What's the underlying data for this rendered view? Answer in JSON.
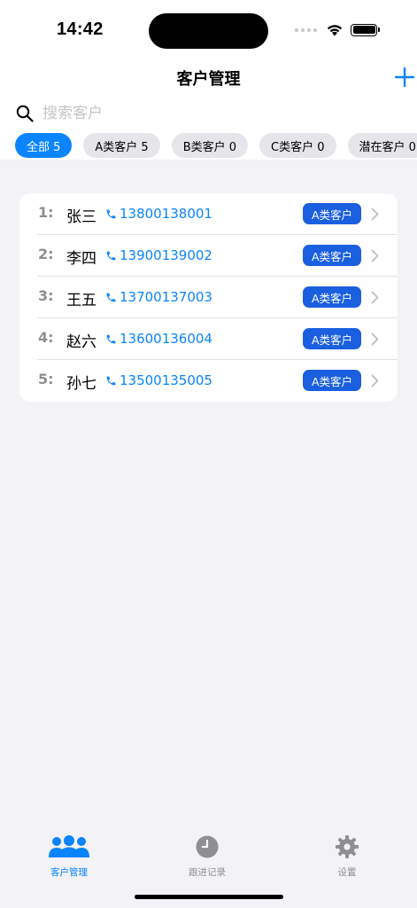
{
  "status_bar": {
    "time": "14:42"
  },
  "nav": {
    "title": "客户管理"
  },
  "search": {
    "placeholder": "搜索客户"
  },
  "filters": [
    {
      "label": "全部 5",
      "active": true
    },
    {
      "label": "A类客户 5",
      "active": false
    },
    {
      "label": "B类客户 0",
      "active": false
    },
    {
      "label": "C类客户 0",
      "active": false
    },
    {
      "label": "潜在客户 0",
      "active": false
    }
  ],
  "customers": [
    {
      "index": "1:",
      "name": "张三",
      "phone": "13800138001",
      "category": "A类客户"
    },
    {
      "index": "2:",
      "name": "李四",
      "phone": "13900139002",
      "category": "A类客户"
    },
    {
      "index": "3:",
      "name": "王五",
      "phone": "13700137003",
      "category": "A类客户"
    },
    {
      "index": "4:",
      "name": "赵六",
      "phone": "13600136004",
      "category": "A类客户"
    },
    {
      "index": "5:",
      "name": "孙七",
      "phone": "13500135005",
      "category": "A类客户"
    }
  ],
  "tabbar": {
    "customers": "客户管理",
    "followups": "跟进记录",
    "settings": "设置"
  },
  "colors": {
    "accent": "#0a84ff",
    "badge": "#1a5fe0",
    "background": "#f2f2f7"
  }
}
